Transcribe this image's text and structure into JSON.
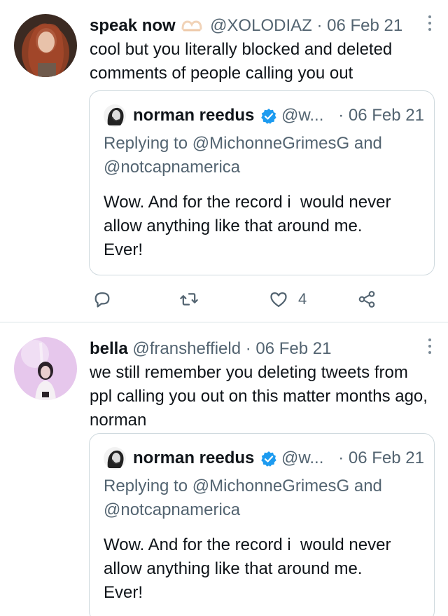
{
  "tweets": [
    {
      "author_name": "speak now",
      "author_handle": "@XOLODIAZ",
      "separator": "·",
      "date": "06 Feb 21",
      "name_emoji": "heart-hands-emoji",
      "text": "cool but you literally blocked and deleted comments of people calling you out",
      "quote": {
        "author_name": "norman reedus",
        "author_handle": "@w...",
        "date": "· 06 Feb 21",
        "replying_prefix": "Replying to ",
        "replying_to_1": "@MichonneGrimesG",
        "replying_and": " and",
        "replying_to_2": "@notcapnamerica",
        "body_line1": "Wow. And for the record i  would never",
        "body_line2": "allow anything like that around me.",
        "body_line3": "Ever!"
      },
      "actions": {
        "reply_icon": "reply-icon",
        "retweet_icon": "retweet-icon",
        "like_icon": "like-icon",
        "like_count": "4",
        "share_icon": "share-icon"
      }
    },
    {
      "author_name": "bella",
      "author_handle": "@fransheffield",
      "separator": "·",
      "date": "06 Feb 21",
      "text": "we still remember you deleting tweets from ppl calling you out on this matter months ago, norman",
      "quote": {
        "author_name": "norman reedus",
        "author_handle": "@w...",
        "date": "· 06 Feb 21",
        "replying_prefix": "Replying to ",
        "replying_to_1": "@MichonneGrimesG",
        "replying_and": " and",
        "replying_to_2": "@notcapnamerica",
        "body_line1": "Wow. And for the record i  would never",
        "body_line2": "allow anything like that around me.",
        "body_line3": "Ever!"
      }
    }
  ],
  "colors": {
    "text_primary": "#0f1419",
    "text_secondary": "#536471",
    "border": "#cfd9de",
    "verified": "#1d9bf0"
  }
}
